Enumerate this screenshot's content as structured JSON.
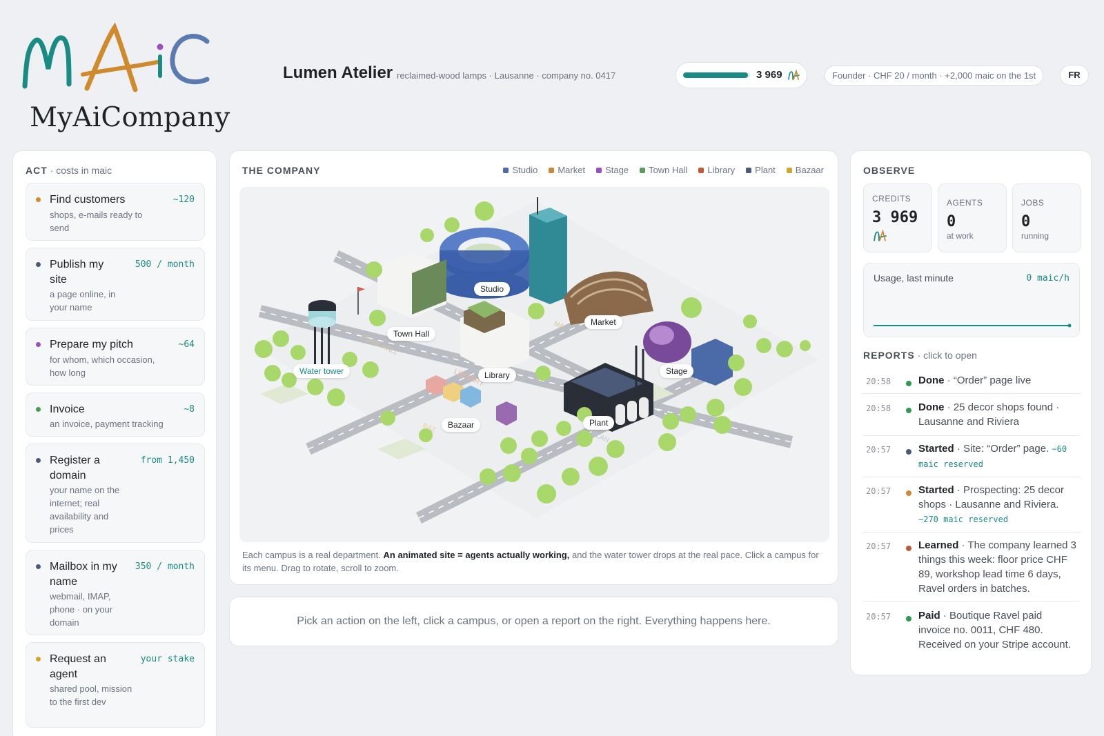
{
  "brand": {
    "logo_text": "MAiC",
    "name": "MyAiCompany"
  },
  "company": {
    "name": "Lumen Atelier",
    "subtitle": "reclaimed-wood lamps · Lausanne · company no. 0417"
  },
  "credits": {
    "value": "3 969",
    "progress": 0.97
  },
  "plan": {
    "label": "Founder · CHF 20 / month · +2,000 maic on the 1st"
  },
  "language": {
    "label": "FR"
  },
  "act": {
    "title": "ACT",
    "subtitle": "· costs in maic",
    "items": [
      {
        "title": "Find customers",
        "desc": "shops, e-mails ready to send",
        "cost": "~120",
        "color": "#d08a2e"
      },
      {
        "title": "Publish my site",
        "desc": "a page online, in your name",
        "cost": "500 / month",
        "color": "#4a5a78"
      },
      {
        "title": "Prepare my pitch",
        "desc": "for whom, which occasion, how long",
        "cost": "~64",
        "color": "#9b4fbf"
      },
      {
        "title": "Invoice",
        "desc": "an invoice, payment tracking",
        "cost": "~8",
        "color": "#4a9a54"
      },
      {
        "title": "Register a domain",
        "desc": "your name on the internet; real availability and prices",
        "cost": "from 1,450",
        "color": "#4a5a78"
      },
      {
        "title": "Mailbox in my name",
        "desc": "webmail, IMAP, phone · on your domain",
        "cost": "350 / month",
        "color": "#4a5a78"
      },
      {
        "title": "Request an agent",
        "desc": "shared pool, mission to the first dev",
        "cost": "your stake",
        "color": "#d0a82e"
      }
    ]
  },
  "company_map": {
    "title": "THE COMPANY",
    "legend": [
      {
        "label": "Studio",
        "color": "#4a6aa8"
      },
      {
        "label": "Market",
        "color": "#c88a3a"
      },
      {
        "label": "Stage",
        "color": "#9b4fbf"
      },
      {
        "label": "Town Hall",
        "color": "#5a9a5a"
      },
      {
        "label": "Library",
        "color": "#c0583a"
      },
      {
        "label": "Plant",
        "color": "#4a5a78"
      },
      {
        "label": "Bazaar",
        "color": "#d0a82e"
      }
    ],
    "labels": {
      "studio": "Studio",
      "market": "Market",
      "town_hall": "Town Hall",
      "water_tower": "Water tower",
      "library": "Library",
      "stage": "Stage",
      "bazaar": "Bazaar",
      "plant": "Plant"
    },
    "road_labels": {
      "town_hall": "TOWN HALL",
      "library": "LIBRARY",
      "market": "MA",
      "bazaar": "BAZ",
      "plant": "PLAN"
    },
    "caption_a": "Each campus is a real department.",
    "caption_b": "An animated site = agents actually working,",
    "caption_c": "and the water tower drops at the real pace. Click a campus for its menu. Drag to rotate, scroll to zoom."
  },
  "hint": {
    "text": "Pick an action on the left, click a campus, or open a report on the right. Everything happens here."
  },
  "observe": {
    "title": "OBSERVE",
    "stats": [
      {
        "label": "CREDITS",
        "value": "3 969",
        "sub": ""
      },
      {
        "label": "AGENTS",
        "value": "0",
        "sub": "at work"
      },
      {
        "label": "JOBS",
        "value": "0",
        "sub": "running"
      }
    ],
    "usage": {
      "label": "Usage, last minute",
      "value": "0 maic/h"
    },
    "reports_title": "REPORTS",
    "reports_hint": "· click to open",
    "reports": [
      {
        "time": "20:58",
        "kind": "Done",
        "text": " · “Order” page live",
        "reserved": "",
        "color": "#2e9a52"
      },
      {
        "time": "20:58",
        "kind": "Done",
        "text": " · 25 decor shops found · Lausanne and Riviera",
        "reserved": "",
        "color": "#2e9a52"
      },
      {
        "time": "20:57",
        "kind": "Started",
        "text": " · Site: “Order” page. ",
        "reserved": "−60 maic reserved",
        "color": "#4a5a78"
      },
      {
        "time": "20:57",
        "kind": "Started",
        "text": " · Prospecting: 25 decor shops · Lausanne and Riviera. ",
        "reserved": "−270 maic reserved",
        "color": "#d08a2e"
      },
      {
        "time": "20:57",
        "kind": "Learned",
        "text": " · The company learned 3 things this week: floor price CHF 89, workshop lead time 6 days, Ravel orders in batches.",
        "reserved": "",
        "color": "#c0583a"
      },
      {
        "time": "20:57",
        "kind": "Paid",
        "text": " · Boutique Ravel paid invoice no. 0011, CHF 480. Received on your Stripe account.",
        "reserved": "",
        "color": "#2e9a52"
      }
    ]
  }
}
